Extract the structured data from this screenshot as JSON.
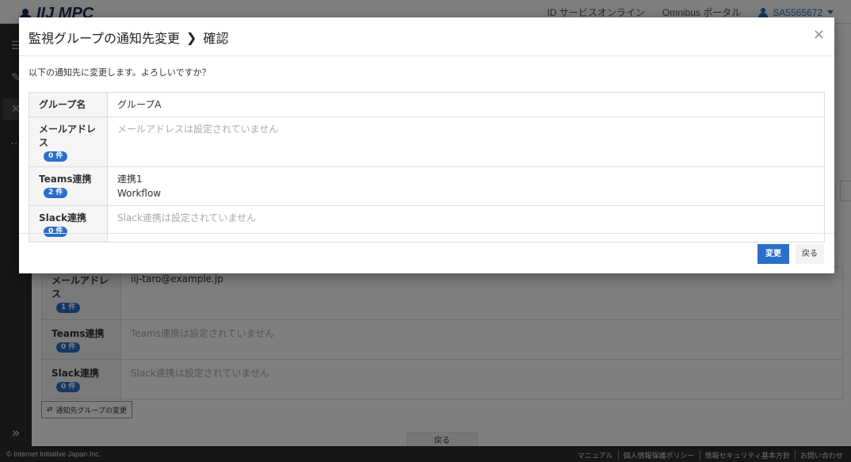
{
  "header": {
    "logo_text": "IIJ MPC",
    "links": [
      "ID サービスオンライン",
      "Omnibus ポータル"
    ],
    "user": "SA5565672",
    "id_fragment": "606"
  },
  "background": {
    "rows": [
      {
        "label": "メールアドレス",
        "count": "1 件",
        "value": "iij-taro@example.jp"
      },
      {
        "label": "Teams連携",
        "count": "0 件",
        "value": "Teams連携は設定されていません"
      },
      {
        "label": "Slack連携",
        "count": "0 件",
        "value": "Slack連携は設定されていません"
      }
    ],
    "change_group_label": "通知先グループの変更",
    "back_label": "戻る"
  },
  "modal": {
    "title": "監視グループの通知先変更",
    "title_step": "確認",
    "close_symbol": "×",
    "message": "以下の通知先に変更します。よろしいですか？",
    "group": {
      "label": "グループ名",
      "value": "グループA"
    },
    "mail": {
      "label": "メールアドレス",
      "count": "0 件",
      "value": "メールアドレスは設定されていません"
    },
    "teams": {
      "label": "Teams連携",
      "count": "2 件",
      "values": [
        "連携1",
        "Workflow"
      ]
    },
    "slack": {
      "label": "Slack連携",
      "count": "0 件",
      "value": "Slack連携は設定されていません"
    },
    "confirm_label": "変更",
    "back_label": "戻る"
  },
  "footer": {
    "copyright": "© Internet Initiative Japan Inc.",
    "links": [
      "マニュアル",
      "個人情報保護ポリシー",
      "情報セキュリティ基本方針",
      "お問い合わせ"
    ]
  },
  "colors": {
    "accent": "#2a6fc9",
    "sidebar": "#2c2c2c"
  }
}
